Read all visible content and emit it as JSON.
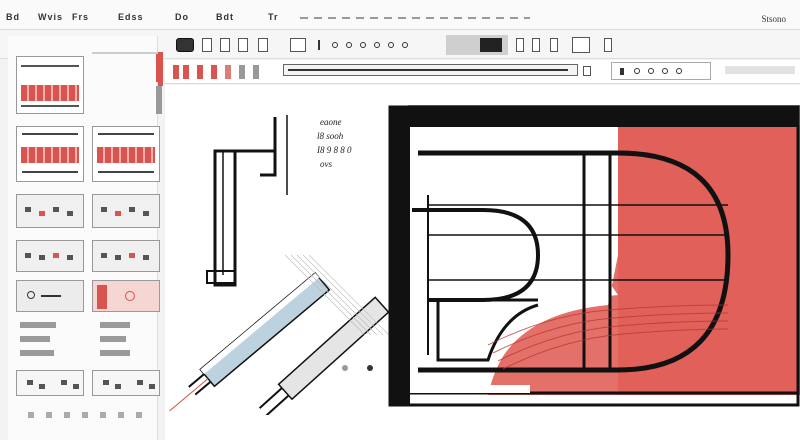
{
  "menubar": {
    "items": [
      "Bd",
      "Wvis",
      "Frs",
      "Edss",
      "Do",
      "Bdt",
      "Tr"
    ],
    "brand": "Stsono"
  },
  "canvas": {
    "annotations": [
      "eaone",
      "l8 sooh",
      "I8 9 8 8 0",
      "ovs"
    ]
  },
  "colors": {
    "accent": "#d9534f",
    "accent_light": "#f2b3ad",
    "ink": "#111111"
  },
  "icons": [
    "undo-icon",
    "redo-icon",
    "pen-icon",
    "dot-icon",
    "save-icon"
  ]
}
